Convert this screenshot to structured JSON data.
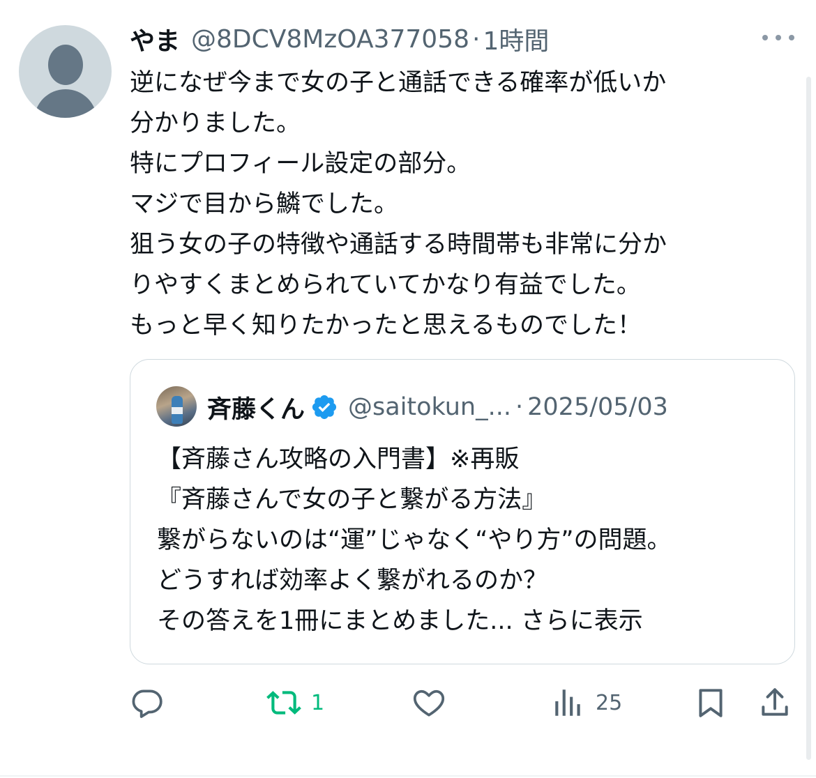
{
  "post": {
    "display_name": "やま",
    "handle": "@8DCV8MzOA377058",
    "separator": "·",
    "time": "1時間",
    "text": "逆になぜ今まで女の子と通話できる確率が低いか\n分かりました。\n特にプロフィール設定の部分。\nマジで目から鱗でした。\n狙う女の子の特徴や通話する時間帯も非常に分か\nりやすくまとめられていてかなり有益でした。\nもっと早く知りたかったと思えるものでした！"
  },
  "quote": {
    "display_name": "斉藤くん",
    "handle": "@saitokun_...",
    "separator": "·",
    "date": "2025/05/03",
    "text": "【斉藤さん攻略の入門書】※再販\n『斉藤さんで女の子と繋がる方法』\n繋がらないのは“運”じゃなく“やり方”の問題。\nどうすれば効率よく繋がれるのか？\nその答えを1冊にまとめました... ",
    "show_more": "さらに表示"
  },
  "actions": {
    "reply_count": "",
    "retweet_count": "1",
    "like_count": "",
    "views_count": "25"
  },
  "colors": {
    "text": "#0f1419",
    "secondary": "#536471",
    "retweet_active": "#00ba7c",
    "verified": "#1d9bf0",
    "border": "#cfd9de"
  },
  "icons": [
    "avatar-default",
    "more-dots-icon",
    "verified-badge-icon",
    "reply-icon",
    "retweet-icon",
    "like-icon",
    "views-icon",
    "bookmark-icon",
    "share-icon"
  ]
}
